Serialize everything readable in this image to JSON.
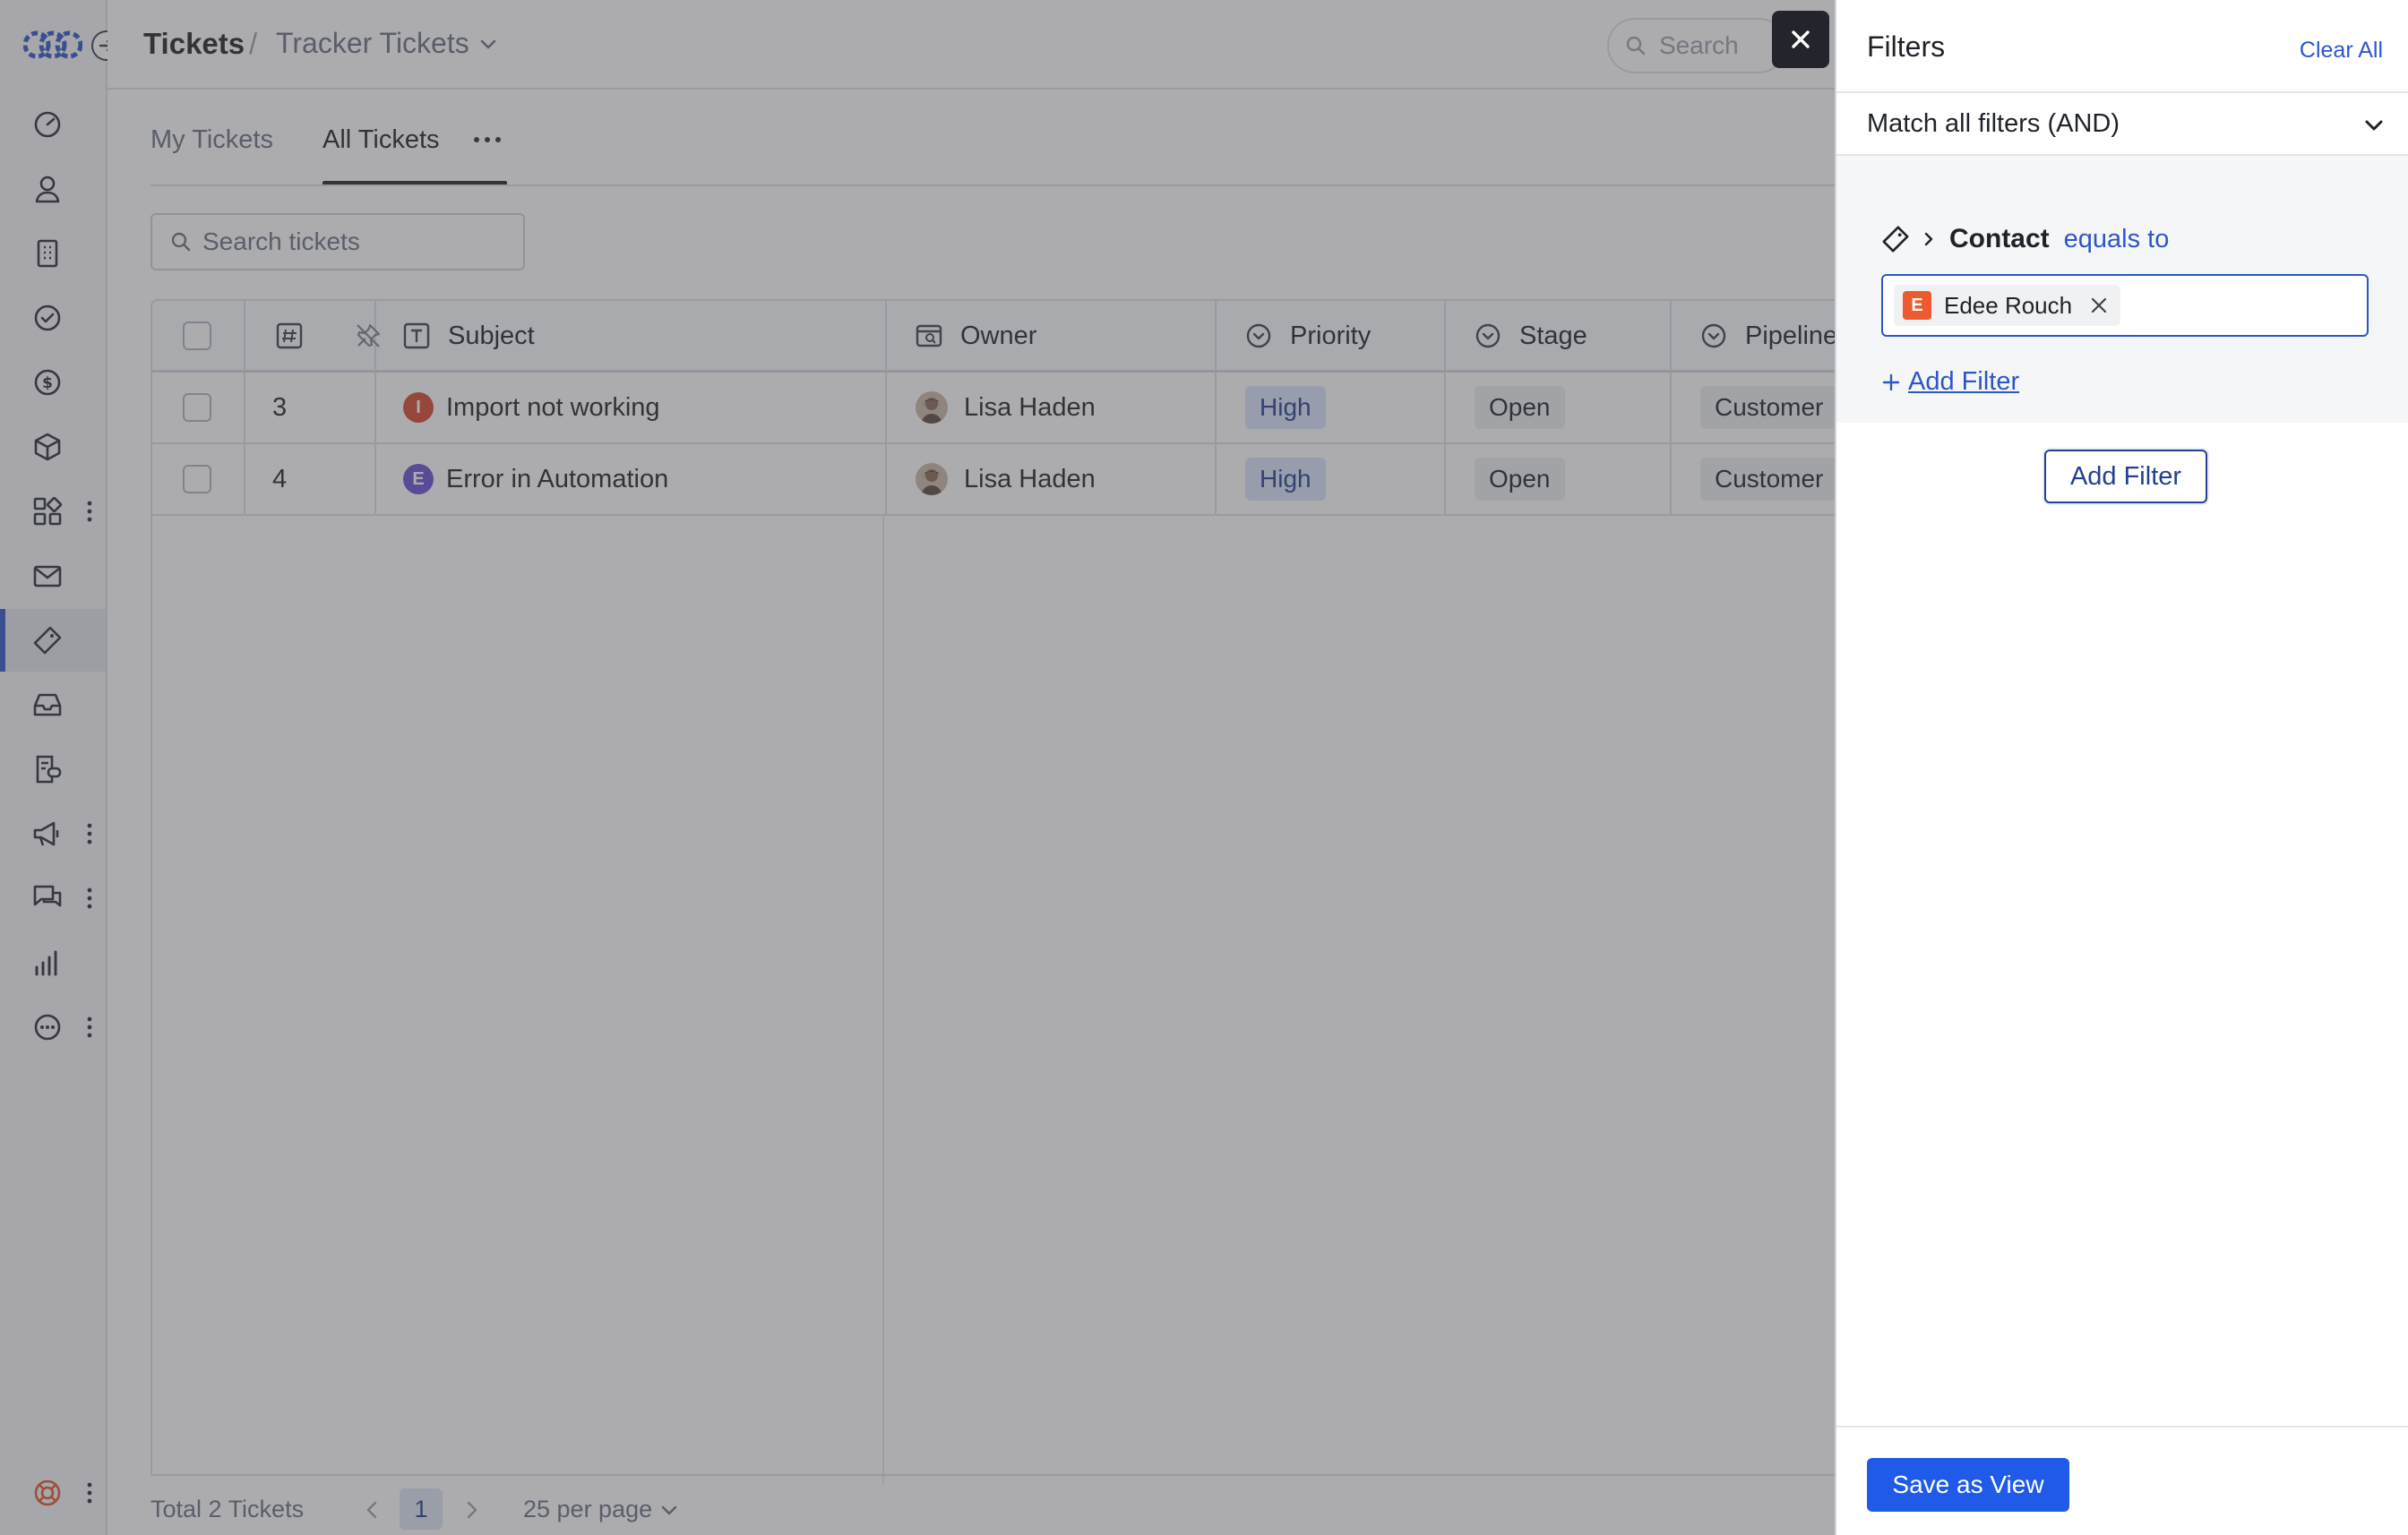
{
  "header": {
    "breadcrumb_root": "Tickets",
    "breadcrumb_separator": "/",
    "breadcrumb_current": "Tracker Tickets",
    "search_label": "Search"
  },
  "tabs": [
    {
      "label": "My Tickets",
      "active": false
    },
    {
      "label": "All Tickets",
      "active": true
    }
  ],
  "ticket_search": {
    "placeholder": "Search tickets"
  },
  "table": {
    "columns": [
      "#",
      "Subject",
      "Owner",
      "Priority",
      "Stage",
      "Pipeline"
    ],
    "rows": [
      {
        "id": "3",
        "subject_initial": "I",
        "subject": "Import not working",
        "owner": "Lisa Haden",
        "priority": "High",
        "stage": "Open",
        "pipeline": "Customer"
      },
      {
        "id": "4",
        "subject_initial": "E",
        "subject": "Error in Automation",
        "owner": "Lisa Haden",
        "priority": "High",
        "stage": "Open",
        "pipeline": "Customer"
      }
    ]
  },
  "footer": {
    "total": "Total 2 Tickets",
    "page": "1",
    "per_page": "25 per page"
  },
  "filters": {
    "title": "Filters",
    "clear_all": "Clear All",
    "match_mode": "Match all filters (AND)",
    "rule": {
      "field": "Contact",
      "operator": "equals to",
      "value_initial": "E",
      "value": "Edee Rouch"
    },
    "add_filter_link": "Add Filter",
    "add_filter_button": "Add Filter",
    "save_view": "Save as View"
  },
  "colors": {
    "accent": "#2f56c9",
    "primary_button": "#1f5ae8",
    "priority_high_bg": "#dbe4fb",
    "subject_initial_I": "#d9462c",
    "subject_initial_E": "#6a4fd1",
    "contact_chip": "#ee5a2f"
  },
  "rail_icons": [
    "dashboard-icon",
    "contacts-icon",
    "companies-icon",
    "tasks-icon",
    "deals-icon",
    "products-icon",
    "apps-icon",
    "email-icon",
    "tickets-icon",
    "inbox-icon",
    "knowledge-icon",
    "campaigns-icon",
    "chat-icon",
    "reports-icon",
    "more-icon",
    "help-icon"
  ]
}
